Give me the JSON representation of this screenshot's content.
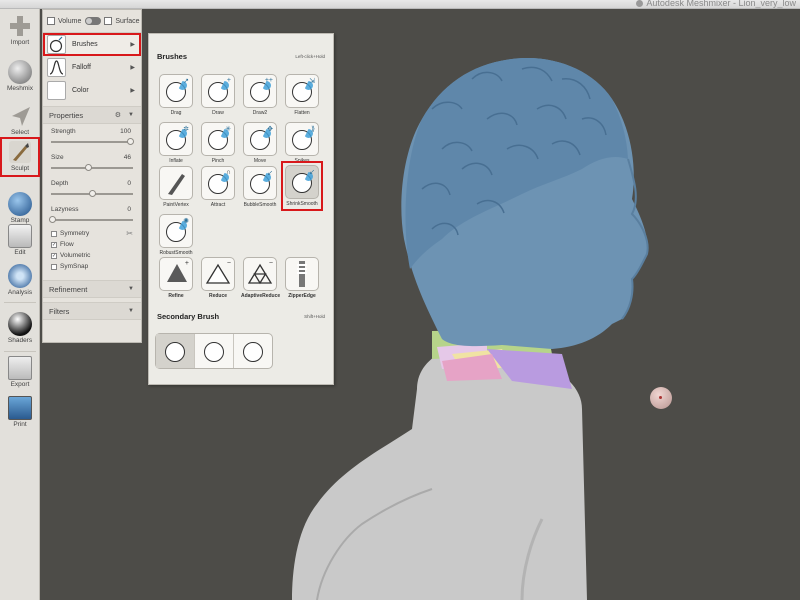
{
  "app": {
    "title": "Autodesk Meshmixer - Lion_very_low"
  },
  "toolbar": {
    "items": [
      {
        "label": "Import",
        "icon": "plus-icon"
      },
      {
        "label": "Meshmix",
        "icon": "meshmix-icon"
      },
      {
        "label": "Select",
        "icon": "select-arrow-icon"
      },
      {
        "label": "Sculpt",
        "icon": "sculpt-brush-icon"
      },
      {
        "label": "Stamp",
        "icon": "stamp-icon"
      },
      {
        "label": "Edit",
        "icon": "edit-icon"
      },
      {
        "label": "Analysis",
        "icon": "analysis-icon"
      },
      {
        "label": "Shaders",
        "icon": "shaders-icon"
      },
      {
        "label": "Export",
        "icon": "export-icon"
      },
      {
        "label": "Print",
        "icon": "print-icon"
      }
    ]
  },
  "panel": {
    "volume_label": "Volume",
    "surface_label": "Surface",
    "brushes_label": "Brushes",
    "falloff_label": "Falloff",
    "color_label": "Color",
    "properties_label": "Properties",
    "strength": {
      "label": "Strength",
      "value": "100"
    },
    "size": {
      "label": "Size",
      "value": "46"
    },
    "depth": {
      "label": "Depth",
      "value": "0"
    },
    "lazyness": {
      "label": "Lazyness",
      "value": "0"
    },
    "checks": [
      {
        "label": "Symmetry",
        "checked": false
      },
      {
        "label": "Flow",
        "checked": true
      },
      {
        "label": "Volumetric",
        "checked": true
      },
      {
        "label": "SymSnap",
        "checked": false
      }
    ],
    "refinement_label": "Refinement",
    "filters_label": "Filters"
  },
  "brushes": {
    "title": "Brushes",
    "hint": "Left-click+Hold",
    "items": [
      "Drag",
      "Draw",
      "Draw2",
      "Flatten",
      "Inflate",
      "Pinch",
      "Move",
      "Spikes",
      "PaintVertex",
      "Attract",
      "BubbleSmooth",
      "ShrinkSmooth",
      "RobustSmooth",
      "Refine",
      "Reduce",
      "AdaptiveReduce",
      "ZipperEdge"
    ],
    "selected": "ShrinkSmooth",
    "secondary_title": "Secondary Brush",
    "secondary_hint": "Shift+Hold"
  },
  "colors": {
    "selection_highlight": "#d8181b",
    "model_blue": "#6d93b3",
    "model_gray": "#c9c9c9",
    "viewport_bg": "#4d4c48"
  }
}
